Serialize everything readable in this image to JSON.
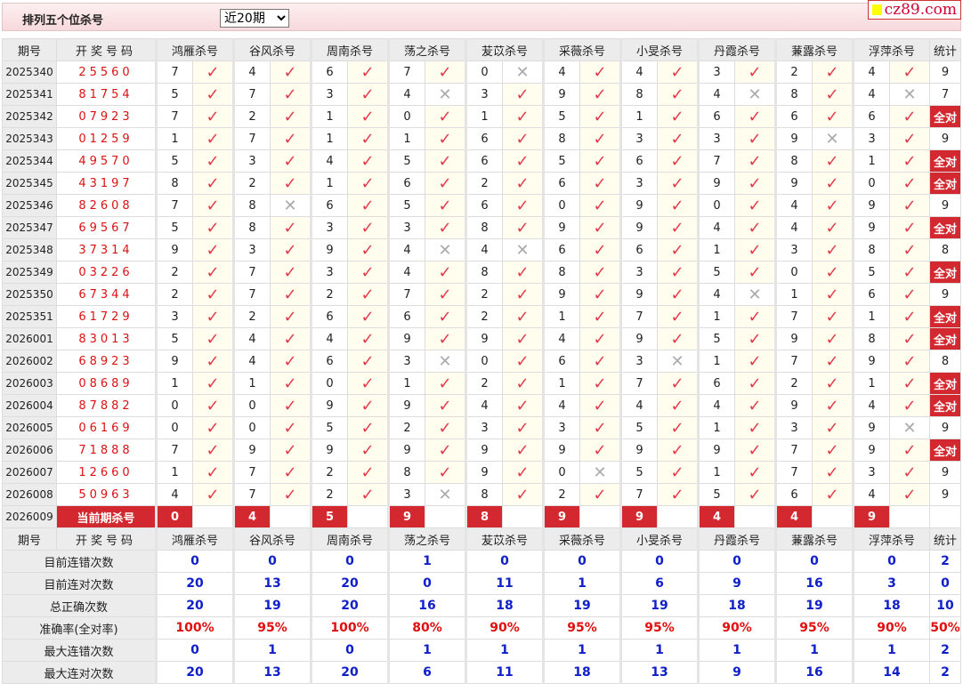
{
  "header": {
    "title": "排列五个位杀号",
    "range_select": "近20期",
    "logo": "cz89.com"
  },
  "columns": {
    "period": "期号",
    "code": "开奖号码",
    "experts": [
      "鸿雁杀号",
      "谷风杀号",
      "周南杀号",
      "荡之杀号",
      "苃苡杀号",
      "采薇杀号",
      "小旻杀号",
      "丹霞杀号",
      "蒹露杀号",
      "浮萍杀号"
    ],
    "stat": "统计"
  },
  "marks": {
    "right": "✓",
    "wrong": "✕",
    "all_right": "全对"
  },
  "rows": [
    {
      "period": "2025340",
      "code": "25560",
      "kills": [
        "7",
        "4",
        "6",
        "7",
        "0",
        "4",
        "4",
        "3",
        "2",
        "4"
      ],
      "wrong": [
        4
      ],
      "stat": "9"
    },
    {
      "period": "2025341",
      "code": "81754",
      "kills": [
        "5",
        "7",
        "3",
        "4",
        "3",
        "9",
        "8",
        "4",
        "8",
        "4"
      ],
      "wrong": [
        3,
        7,
        9
      ],
      "stat": "7"
    },
    {
      "period": "2025342",
      "code": "07923",
      "kills": [
        "7",
        "2",
        "1",
        "0",
        "1",
        "5",
        "1",
        "6",
        "6",
        "6"
      ],
      "wrong": [],
      "stat": "全对"
    },
    {
      "period": "2025343",
      "code": "01259",
      "kills": [
        "1",
        "7",
        "1",
        "1",
        "6",
        "8",
        "3",
        "3",
        "9",
        "3"
      ],
      "wrong": [
        8
      ],
      "stat": "9"
    },
    {
      "period": "2025344",
      "code": "49570",
      "kills": [
        "5",
        "3",
        "4",
        "5",
        "6",
        "5",
        "6",
        "7",
        "8",
        "1"
      ],
      "wrong": [],
      "stat": "全对"
    },
    {
      "period": "2025345",
      "code": "43197",
      "kills": [
        "8",
        "2",
        "1",
        "6",
        "2",
        "6",
        "3",
        "9",
        "9",
        "0"
      ],
      "wrong": [],
      "stat": "全对"
    },
    {
      "period": "2025346",
      "code": "82608",
      "kills": [
        "7",
        "8",
        "6",
        "5",
        "6",
        "0",
        "9",
        "0",
        "4",
        "9"
      ],
      "wrong": [
        1
      ],
      "stat": "9"
    },
    {
      "period": "2025347",
      "code": "69567",
      "kills": [
        "5",
        "8",
        "3",
        "3",
        "8",
        "9",
        "9",
        "4",
        "4",
        "9"
      ],
      "wrong": [],
      "stat": "全对"
    },
    {
      "period": "2025348",
      "code": "37314",
      "kills": [
        "9",
        "3",
        "9",
        "4",
        "4",
        "6",
        "6",
        "1",
        "3",
        "8"
      ],
      "wrong": [
        3,
        4
      ],
      "stat": "8"
    },
    {
      "period": "2025349",
      "code": "03226",
      "kills": [
        "2",
        "7",
        "3",
        "4",
        "8",
        "8",
        "3",
        "5",
        "0",
        "5"
      ],
      "wrong": [],
      "stat": "全对"
    },
    {
      "period": "2025350",
      "code": "67344",
      "kills": [
        "2",
        "7",
        "2",
        "7",
        "2",
        "9",
        "9",
        "4",
        "1",
        "6"
      ],
      "wrong": [
        7
      ],
      "stat": "9"
    },
    {
      "period": "2025351",
      "code": "61729",
      "kills": [
        "3",
        "2",
        "6",
        "6",
        "2",
        "1",
        "7",
        "1",
        "7",
        "1"
      ],
      "wrong": [],
      "stat": "全对"
    },
    {
      "period": "2026001",
      "code": "83013",
      "kills": [
        "5",
        "4",
        "4",
        "9",
        "9",
        "4",
        "9",
        "5",
        "9",
        "8"
      ],
      "wrong": [],
      "stat": "全对"
    },
    {
      "period": "2026002",
      "code": "68923",
      "kills": [
        "9",
        "4",
        "6",
        "3",
        "0",
        "6",
        "3",
        "1",
        "7",
        "9"
      ],
      "wrong": [
        3,
        6
      ],
      "stat": "8"
    },
    {
      "period": "2026003",
      "code": "08689",
      "kills": [
        "1",
        "1",
        "0",
        "1",
        "2",
        "1",
        "7",
        "6",
        "2",
        "1"
      ],
      "wrong": [],
      "stat": "全对"
    },
    {
      "period": "2026004",
      "code": "87882",
      "kills": [
        "0",
        "0",
        "9",
        "9",
        "4",
        "4",
        "4",
        "4",
        "9",
        "4"
      ],
      "wrong": [],
      "stat": "全对"
    },
    {
      "period": "2026005",
      "code": "06169",
      "kills": [
        "0",
        "0",
        "5",
        "2",
        "3",
        "3",
        "5",
        "1",
        "3",
        "9"
      ],
      "wrong": [
        9
      ],
      "stat": "9"
    },
    {
      "period": "2026006",
      "code": "71888",
      "kills": [
        "7",
        "9",
        "9",
        "9",
        "9",
        "9",
        "9",
        "9",
        "7",
        "9"
      ],
      "wrong": [],
      "stat": "全对"
    },
    {
      "period": "2026007",
      "code": "12660",
      "kills": [
        "1",
        "7",
        "2",
        "8",
        "9",
        "0",
        "5",
        "1",
        "7",
        "3"
      ],
      "wrong": [
        5
      ],
      "stat": "9"
    },
    {
      "period": "2026008",
      "code": "50963",
      "kills": [
        "4",
        "7",
        "2",
        "3",
        "8",
        "2",
        "7",
        "5",
        "6",
        "4"
      ],
      "wrong": [
        3
      ],
      "stat": "9"
    }
  ],
  "current": {
    "period": "2026009",
    "label": "当前期杀号",
    "kills": [
      "0",
      "4",
      "5",
      "9",
      "8",
      "9",
      "9",
      "4",
      "4",
      "9"
    ]
  },
  "summary": [
    {
      "label": "目前连错次数",
      "values": [
        "0",
        "0",
        "0",
        "1",
        "0",
        "0",
        "0",
        "0",
        "0",
        "0"
      ],
      "stat": "2",
      "color": "blue"
    },
    {
      "label": "目前连对次数",
      "values": [
        "20",
        "13",
        "20",
        "0",
        "11",
        "1",
        "6",
        "9",
        "16",
        "3"
      ],
      "stat": "0",
      "color": "blue"
    },
    {
      "label": "总正确次数",
      "values": [
        "20",
        "19",
        "20",
        "16",
        "18",
        "19",
        "19",
        "18",
        "19",
        "18"
      ],
      "stat": "10",
      "color": "blue"
    },
    {
      "label": "准确率(全对率)",
      "values": [
        "100%",
        "95%",
        "100%",
        "80%",
        "90%",
        "95%",
        "95%",
        "90%",
        "95%",
        "90%"
      ],
      "stat": "50%",
      "color": "red"
    },
    {
      "label": "最大连错次数",
      "values": [
        "0",
        "1",
        "0",
        "1",
        "1",
        "1",
        "1",
        "1",
        "1",
        "1"
      ],
      "stat": "2",
      "color": "blue"
    },
    {
      "label": "最大连对次数",
      "values": [
        "20",
        "13",
        "20",
        "6",
        "11",
        "18",
        "13",
        "9",
        "16",
        "14"
      ],
      "stat": "2",
      "color": "blue"
    }
  ]
}
